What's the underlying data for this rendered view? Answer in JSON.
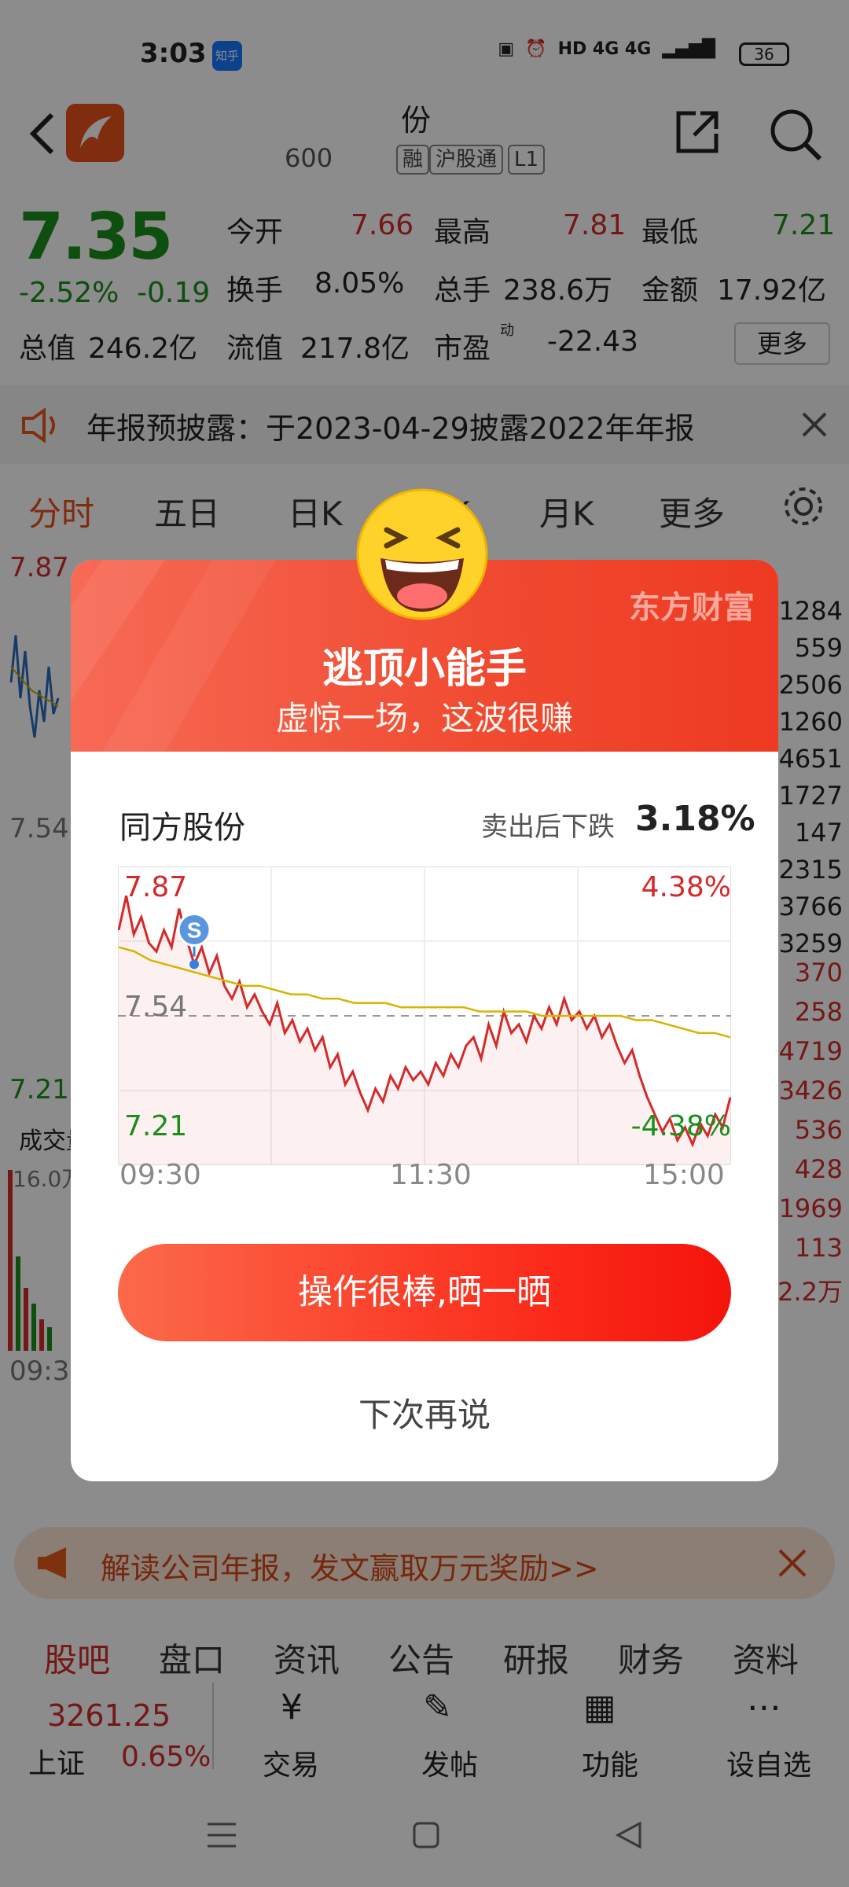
{
  "status_bar": {
    "time": "3:03",
    "app_badge": "知乎",
    "network": "HD 4G 4G",
    "battery": "36"
  },
  "header": {
    "stock_name": "份",
    "stock_code": "600",
    "tag_margin": "融",
    "tag_connect": "沪股通",
    "tag_level": "L1",
    "icons": [
      "back-icon",
      "logo-icon",
      "share-icon",
      "search-icon"
    ]
  },
  "quote": {
    "price": "7.35",
    "change_pct": "-2.52%",
    "change_abs": "-0.19",
    "open_label": "今开",
    "open_value": "7.66",
    "high_label": "最高",
    "high_value": "7.81",
    "low_label": "最低",
    "low_value": "7.21",
    "turnover_label": "换手",
    "turnover_value": "8.05%",
    "volume_label": "总手",
    "volume_value": "238.6万",
    "amount_label": "金额",
    "amount_value": "17.92亿",
    "mktcap_label": "总值",
    "mktcap_value": "246.2亿",
    "float_label": "流值",
    "float_value": "217.8亿",
    "pe_label": "市盈",
    "pe_sup": "动",
    "pe_value": "-22.43",
    "more_label": "更多"
  },
  "notice": {
    "text": "年报预披露：于2023-04-29披露2022年年报"
  },
  "chart_tabs": [
    "分时",
    "五日",
    "日K",
    "周K",
    "月K",
    "更多"
  ],
  "background_chart": {
    "price_hi": "7.87",
    "price_mid": "7.54",
    "price_lo": "7.21",
    "vol_label": "成交量",
    "vol_max": "16.0万",
    "time_start": "09:30",
    "right_nums": [
      "1284",
      "559",
      "2506",
      "1260",
      "4651",
      "1727",
      "147",
      "2315",
      "3766",
      "3259",
      "370",
      "258",
      "4719",
      "3426",
      "536",
      "428",
      "1969",
      "113",
      "2.2万"
    ]
  },
  "promo": {
    "text": "解读公司年报，发文赢取万元奖励>>"
  },
  "bottom_tabs": [
    "股吧",
    "盘口",
    "资讯",
    "公告",
    "研报",
    "财务",
    "资料"
  ],
  "bottom_bar": {
    "index_value": "3261.25",
    "index_name": "上证",
    "index_change": "0.65%",
    "actions": [
      "交易",
      "发帖",
      "功能",
      "设自选"
    ]
  },
  "dialog": {
    "brand": "东方财富",
    "title": "逃顶小能手",
    "subtitle": "虚惊一场，这波很赚",
    "stock_name": "同方股份",
    "drop_label": "卖出后下跌",
    "drop_value": "3.18%",
    "sell_marker": "S",
    "share_button": "操作很棒,晒一晒",
    "later_button": "下次再说"
  },
  "chart_data": {
    "type": "line",
    "title": "",
    "y_left_labels": [
      "7.87",
      "7.54",
      "7.21"
    ],
    "y_right_labels": [
      "4.38%",
      "-4.38%"
    ],
    "x_labels": [
      "09:30",
      "11:30",
      "15:00"
    ],
    "ylim": [
      7.21,
      7.87
    ],
    "reference_price": 7.54,
    "series": [
      {
        "values": [
          7.74,
          7.82,
          7.73,
          7.77,
          7.71,
          7.69,
          7.74,
          7.7,
          7.79,
          7.72,
          7.66,
          7.7,
          7.64,
          7.68,
          7.61,
          7.58,
          7.62,
          7.56,
          7.59,
          7.55,
          7.52,
          7.57,
          7.5,
          7.53,
          7.48,
          7.51,
          7.46,
          7.49,
          7.42,
          7.45,
          7.38,
          7.41,
          7.36,
          7.32,
          7.37,
          7.34,
          7.4,
          7.37,
          7.42,
          7.39,
          7.41,
          7.38,
          7.43,
          7.4,
          7.45,
          7.42,
          7.47,
          7.49,
          7.44,
          7.52,
          7.47,
          7.55,
          7.5,
          7.52,
          7.48,
          7.54,
          7.51,
          7.56,
          7.52,
          7.58,
          7.53,
          7.55,
          7.51,
          7.54,
          7.49,
          7.52,
          7.47,
          7.43,
          7.46,
          7.4,
          7.35,
          7.31,
          7.27,
          7.3,
          7.25,
          7.28,
          7.24,
          7.29,
          7.26,
          7.31,
          7.28,
          7.35
        ]
      },
      {
        "values": [
          7.7,
          7.69,
          7.67,
          7.66,
          7.65,
          7.64,
          7.63,
          7.62,
          7.61,
          7.61,
          7.6,
          7.59,
          7.59,
          7.58,
          7.58,
          7.57,
          7.57,
          7.57,
          7.56,
          7.56,
          7.56,
          7.56,
          7.56,
          7.55,
          7.55,
          7.55,
          7.55,
          7.54,
          7.54,
          7.54,
          7.54,
          7.54,
          7.54,
          7.53,
          7.53,
          7.52,
          7.51,
          7.5,
          7.5,
          7.49
        ]
      }
    ],
    "grid": true
  }
}
